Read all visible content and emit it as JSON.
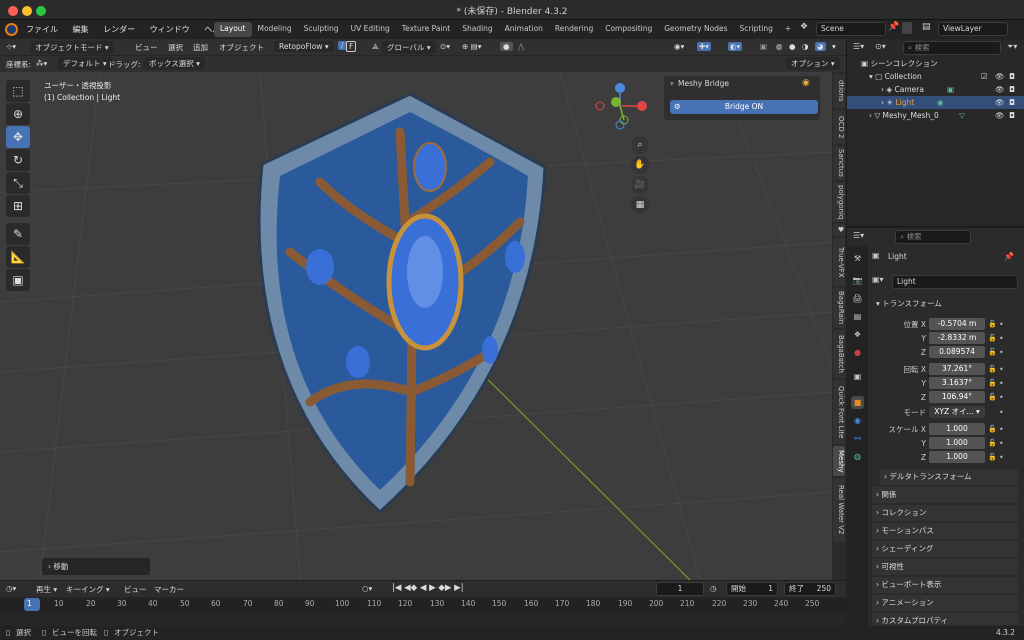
{
  "window": {
    "title": "* (未保存) - Blender 4.3.2"
  },
  "menu": [
    "ファイル",
    "編集",
    "レンダー",
    "ウィンドウ",
    "ヘルプ"
  ],
  "workspaces": [
    "Layout",
    "Modeling",
    "Sculpting",
    "UV Editing",
    "Texture Paint",
    "Shading",
    "Animation",
    "Rendering",
    "Compositing",
    "Geometry Nodes",
    "Scripting"
  ],
  "active_workspace": "Layout",
  "scene": {
    "label": "Scene"
  },
  "viewlayer": {
    "label": "ViewLayer"
  },
  "header": {
    "mode": "オブジェクトモード",
    "menus": [
      "ビュー",
      "選択",
      "追加",
      "オブジェクト"
    ],
    "retopo": "RetopoFlow",
    "shortcut_f": "F",
    "orientation": "グローバル"
  },
  "header2": {
    "coord_label": "座標系:",
    "coord_value": "デフォルト",
    "drag_label": "ドラッグ:",
    "drag_value": "ボックス選択",
    "options": "オプション"
  },
  "viewport": {
    "line1": "ユーザー・透視投影",
    "line2": "(1) Collection | Light"
  },
  "npanel": {
    "title": "Meshy Bridge",
    "button": "Bridge ON"
  },
  "sidetabs": [
    "dtions",
    "OCD 2",
    "Sanctus",
    "polygoniq",
    "True-VFX",
    "BagaRain",
    "BagaBatch",
    "Quick Font Lite",
    "Meshy",
    "Real Water V2"
  ],
  "active_sidetab": "Meshy",
  "operator_panel": "移動",
  "outliner": {
    "search_placeholder": "検索",
    "scene_collection": "シーンコレクション",
    "items": [
      {
        "name": "Collection"
      },
      {
        "name": "Camera"
      },
      {
        "name": "Light"
      },
      {
        "name": "Meshy_Mesh_0"
      }
    ]
  },
  "properties": {
    "search_placeholder": "検索",
    "object_name": "Light",
    "object_field": "Light",
    "transform_label": "トランスフォーム",
    "location_label": "位置",
    "location": {
      "x": "-0.5704 m",
      "y": "-2.8332 m",
      "z": "0.089574"
    },
    "rotation_label": "回転",
    "rotation": {
      "x": "37.261°",
      "y": "3.1637°",
      "z": "106.94°"
    },
    "mode_label": "モード",
    "mode_value": "XYZ オイ...",
    "scale_label": "スケール",
    "scale": {
      "x": "1.000",
      "y": "1.000",
      "z": "1.000"
    },
    "axis": {
      "x": "X",
      "y": "Y",
      "z": "Z"
    },
    "delta": "デルタトランスフォーム",
    "sections": [
      "関係",
      "コレクション",
      "モーションパス",
      "シェーディング",
      "可視性",
      "ビューポート表示",
      "アニメーション",
      "カスタムプロパティ"
    ]
  },
  "timeline": {
    "menus": [
      "再生",
      "キーイング",
      "ビュー",
      "マーカー"
    ],
    "current_frame": "1",
    "start_label": "開始",
    "start": "1",
    "end_label": "終了",
    "end": "250",
    "ticks": [
      "1",
      "10",
      "20",
      "30",
      "40",
      "50",
      "60",
      "70",
      "80",
      "90",
      "100",
      "110",
      "120",
      "130",
      "140",
      "150",
      "160",
      "170",
      "180",
      "190",
      "200",
      "210",
      "220",
      "230",
      "240",
      "250"
    ]
  },
  "statusbar": {
    "select": "選択",
    "rotate_view": "ビューを回転",
    "object": "オブジェクト",
    "version": "4.3.2"
  },
  "colors": {
    "accent": "#4772b3",
    "selection": "#344e7a",
    "gem": "#3a6fd8"
  }
}
